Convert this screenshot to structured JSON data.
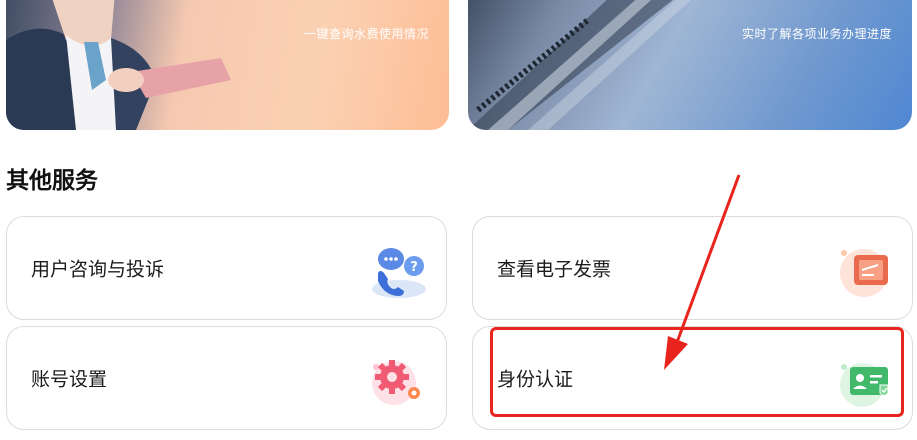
{
  "banners": [
    {
      "caption": "一键查询水费使用情况"
    },
    {
      "caption": "实时了解各项业务办理进度"
    }
  ],
  "section": {
    "title": "其他服务"
  },
  "services": [
    {
      "label": "用户咨询与投诉",
      "icon": "customer-service-chat-icon"
    },
    {
      "label": "查看电子发票",
      "icon": "invoice-folder-icon"
    },
    {
      "label": "账号设置",
      "icon": "gear-settings-icon"
    },
    {
      "label": "身份认证",
      "icon": "id-card-verification-icon"
    }
  ],
  "annotation": {
    "highlight_color": "#e8241c",
    "highlighted_item": "身份认证"
  }
}
